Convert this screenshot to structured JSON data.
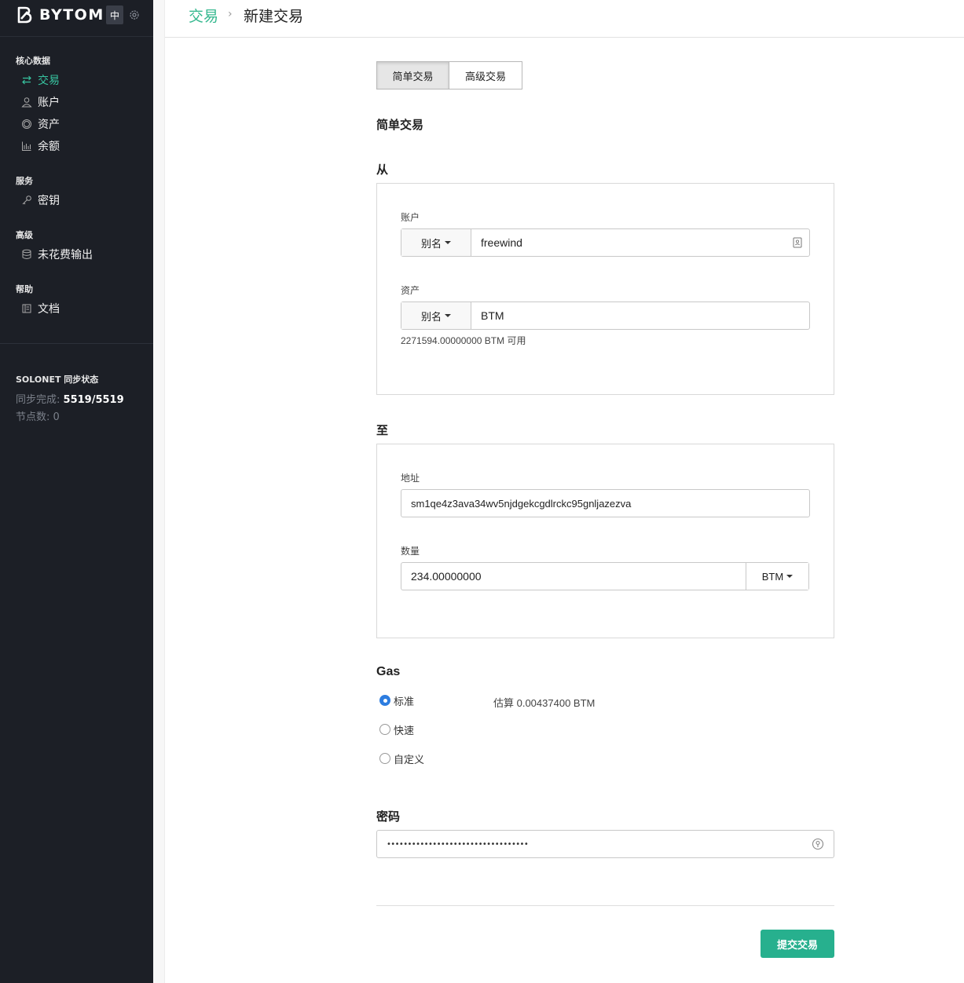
{
  "app": {
    "brand": "BYTOM",
    "lang_button": "中"
  },
  "sidebar": {
    "sections": [
      {
        "title": "核心数据",
        "items": [
          {
            "label": "交易",
            "icon": "swap-icon",
            "active": true
          },
          {
            "label": "账户",
            "icon": "user-icon"
          },
          {
            "label": "资产",
            "icon": "circle-icon"
          },
          {
            "label": "余额",
            "icon": "bar-chart-icon"
          }
        ]
      },
      {
        "title": "服务",
        "items": [
          {
            "label": "密钥",
            "icon": "key-icon"
          }
        ]
      },
      {
        "title": "高级",
        "items": [
          {
            "label": "未花费输出",
            "icon": "database-icon"
          }
        ]
      },
      {
        "title": "帮助",
        "items": [
          {
            "label": "文档",
            "icon": "doc-icon"
          }
        ]
      }
    ],
    "sync": {
      "title": "SOLONET 同步状态",
      "progress_label": "同步完成:",
      "progress_value": "5519/5519",
      "peers_label": "节点数:",
      "peers_value": "0"
    }
  },
  "header": {
    "breadcrumb_parent": "交易",
    "breadcrumb_separator": "›",
    "breadcrumb_current": "新建交易"
  },
  "tabs": [
    {
      "label": "简单交易",
      "active": true
    },
    {
      "label": "高级交易",
      "active": false
    }
  ],
  "form": {
    "section_title": "简单交易",
    "from": {
      "heading": "从",
      "account_label": "账户",
      "account_mode": "别名",
      "account_value": "freewind",
      "asset_label": "资产",
      "asset_mode": "别名",
      "asset_value": "BTM",
      "available_text": "2271594.00000000 BTM 可用"
    },
    "to": {
      "heading": "至",
      "address_label": "地址",
      "address_value": "sm1qe4z3ava34wv5njdgekcgdlrckc95gnljazezva",
      "amount_label": "数量",
      "amount_value": "234.00000000",
      "amount_unit": "BTM"
    },
    "gas": {
      "heading": "Gas",
      "options": [
        {
          "label": "标准",
          "selected": true
        },
        {
          "label": "快速",
          "selected": false
        },
        {
          "label": "自定义",
          "selected": false
        }
      ],
      "estimate_text": "估算 0.00437400 BTM"
    },
    "password": {
      "heading": "密码",
      "masked_value": "••••••••••••••••••••••••••••••••••"
    },
    "submit_label": "提交交易"
  },
  "colors": {
    "accent": "#35b88f",
    "sidebar_bg": "#1c1f26",
    "submit_bg": "#27b08e",
    "radio_selected": "#2d7de0"
  }
}
